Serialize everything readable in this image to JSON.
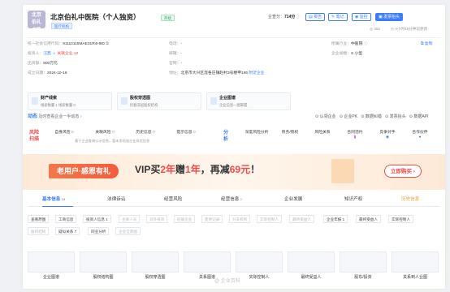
{
  "company": {
    "logo_text": "北京伯礼\n中医",
    "name": "北京伯礼中医院（个人独资）",
    "status": "存续",
    "type_tag": "医疗机构",
    "score_label": "企查分：",
    "score_value": "714分",
    "views": "352",
    "updated": "3小时48分钟前更新"
  },
  "top_buttons": [
    "报告",
    "笔记",
    "监控",
    "发票抬头"
  ],
  "info": {
    "credit_code_label": "统一社会信用代码：",
    "credit_code": "91110115MAE31R4H9D",
    "investor_label": "投资人：",
    "investor": "汪茜",
    "investor_risk": "关联企业 13",
    "capital_label": "出资额：",
    "capital": "500万元",
    "founded_label": "成立日期：",
    "founded": "2024-10-18",
    "phone_label": "电话：",
    "phone": "-",
    "email_label": "邮箱：",
    "email": "-",
    "website_label": "官网：",
    "website": "-",
    "address_label": "地址：",
    "address": "北京市大兴区庞各庄镇赵村3号楼甲165",
    "address_link": "附近企业",
    "scale_label": "企业规模：",
    "scale": "小型",
    "size_label": "企业规模：",
    "size": "S 小型",
    "copy": "复制",
    "industry_label": "所属行业：",
    "industry": "中医院"
  },
  "mini_cards": [
    {
      "title": "财产线索",
      "sub": "线索数量 1   线索数量 0"
    },
    {
      "title": "股权穿透图",
      "sub": "挖掘深层股权结构"
    },
    {
      "title": "企业图谱",
      "sub": "企业信息一图掌握"
    }
  ],
  "dynamic": {
    "label": "动态",
    "text": "及时查看企业一手动态",
    "actions": [
      "认领企业",
      "企业PK",
      "数据纠错",
      "发票抬头",
      "数据API"
    ]
  },
  "risk": {
    "label": "风险\n扫描",
    "items": [
      {
        "name": "自身风险",
        "n": "0"
      },
      {
        "name": "关联风险",
        "n": "0"
      },
      {
        "name": "历史信息",
        "n": "0"
      },
      {
        "name": "提示信息",
        "n": "0"
      }
    ],
    "note": "基于企业查询公示信息，暂未发现该企业风险信息",
    "analysis_label": "分\n析",
    "analysis": [
      "深度风险分析",
      "债务/债权",
      "风险关系",
      "合同违约",
      "竞争对手",
      "合作伙伴"
    ]
  },
  "ad": {
    "slogan": "老用户·感恩有礼",
    "offer_prefix": "VIP买",
    "offer_mid": "2年",
    "offer_mid2": "赠",
    "offer_mid3": "1年",
    "offer_suffix": "，再减",
    "offer_amount": "69元",
    "offer_end": "！",
    "cta": "立即购买 ›"
  },
  "tabs": [
    {
      "label": "基本信息",
      "count": "14"
    },
    {
      "label": "法律诉讼",
      "count": ""
    },
    {
      "label": "经营风险",
      "count": ""
    },
    {
      "label": "经营信息",
      "count": "2"
    },
    {
      "label": "企业发展",
      "count": ""
    },
    {
      "label": "知识产权",
      "count": ""
    },
    {
      "label": "历史信息",
      "count": ""
    }
  ],
  "chips_row1": [
    "查看原图",
    "工商信息",
    "投资人信息 1",
    "主要人员",
    "对外投资",
    "控股企业",
    "变更记录",
    "分支机构",
    "实际控制人",
    "最终受益人",
    "企业年报 1",
    "最终受益人",
    "实际控制人"
  ],
  "chips_row2": [
    "股权结构",
    "疑似关系 7",
    "同业分析",
    "企业全景图"
  ],
  "thumbs": [
    "企业图谱",
    "股权结构图",
    "股权穿透图",
    "关系图谱",
    "实际控制人",
    "最终受益人",
    "股东/投资",
    "关系到人业图"
  ],
  "watermark": "@ 企业百科"
}
